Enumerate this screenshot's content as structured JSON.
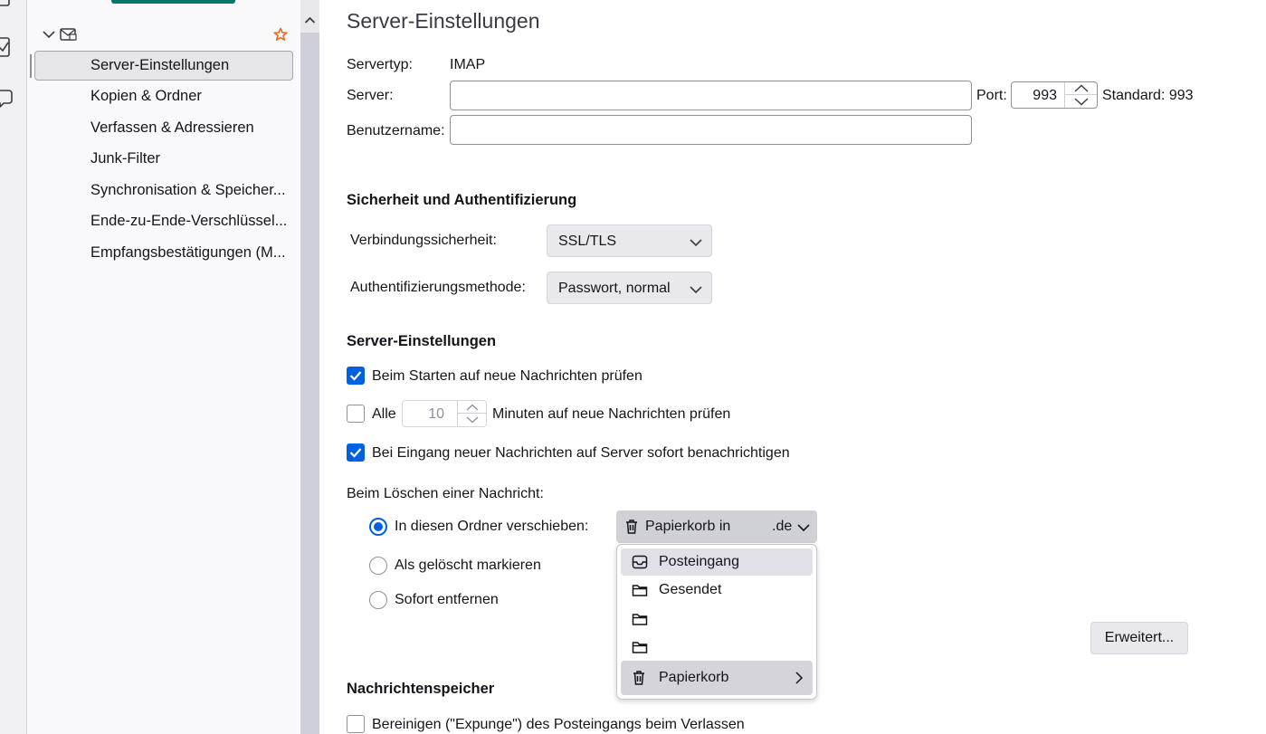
{
  "sidebar": {
    "items": [
      {
        "label": "Server-Einstellungen",
        "selected": true
      },
      {
        "label": "Kopien & Ordner"
      },
      {
        "label": "Verfassen & Adressieren"
      },
      {
        "label": "Junk-Filter"
      },
      {
        "label": "Synchronisation & Speicher..."
      },
      {
        "label": "Ende-zu-Ende-Verschlüssel..."
      },
      {
        "label": "Empfangsbestätigungen (M..."
      }
    ]
  },
  "main": {
    "title": "Server-Einstellungen",
    "server_type_label": "Servertyp:",
    "server_type_value": "IMAP",
    "server_label": "Server:",
    "server_value": "",
    "port_label": "Port:",
    "port_value": "993",
    "port_default": "Standard: 993",
    "username_label": "Benutzername:",
    "username_value": ""
  },
  "security": {
    "heading": "Sicherheit und Authentifizierung",
    "conn_label": "Verbindungssicherheit:",
    "conn_value": "SSL/TLS",
    "auth_label": "Authentifizierungsmethode:",
    "auth_value": "Passwort, normal"
  },
  "server_settings": {
    "heading": "Server-Einstellungen",
    "check_startup_label": "Beim Starten auf neue Nachrichten prüfen",
    "check_startup_checked": true,
    "check_every_label_pre": "Alle",
    "check_every_minutes": "10",
    "check_every_label_post": "Minuten auf neue Nachrichten prüfen",
    "check_every_checked": false,
    "notify_label": "Bei Eingang neuer Nachrichten auf Server sofort benachrichtigen",
    "notify_checked": true,
    "delete_heading": "Beim Löschen einer Nachricht:",
    "opt_move_label": "In diesen Ordner verschieben:",
    "opt_mark_label": "Als gelöscht markieren",
    "opt_remove_label": "Sofort entfernen",
    "selected_option": "move",
    "folder_select_label": "Papierkorb in",
    "folder_select_suffix": ".de"
  },
  "folder_menu": {
    "items": [
      {
        "label": "Posteingang",
        "icon": "inbox-icon"
      },
      {
        "label": "Gesendet",
        "icon": "folder-icon"
      },
      {
        "label": "",
        "icon": "folder-icon"
      },
      {
        "label": "",
        "icon": "folder-icon"
      },
      {
        "label": "Papierkorb",
        "icon": "trash-icon",
        "has_submenu": true
      }
    ]
  },
  "advanced_button": "Erweitert...",
  "storage": {
    "heading": "Nachrichtenspeicher",
    "expunge_label": "Bereinigen (\"Expunge\") des Posteingangs beim Verlassen",
    "expunge_checked": false
  },
  "colors": {
    "accent": "#0061e0",
    "brand_green": "#017a6a",
    "star": "#e66b1f"
  }
}
